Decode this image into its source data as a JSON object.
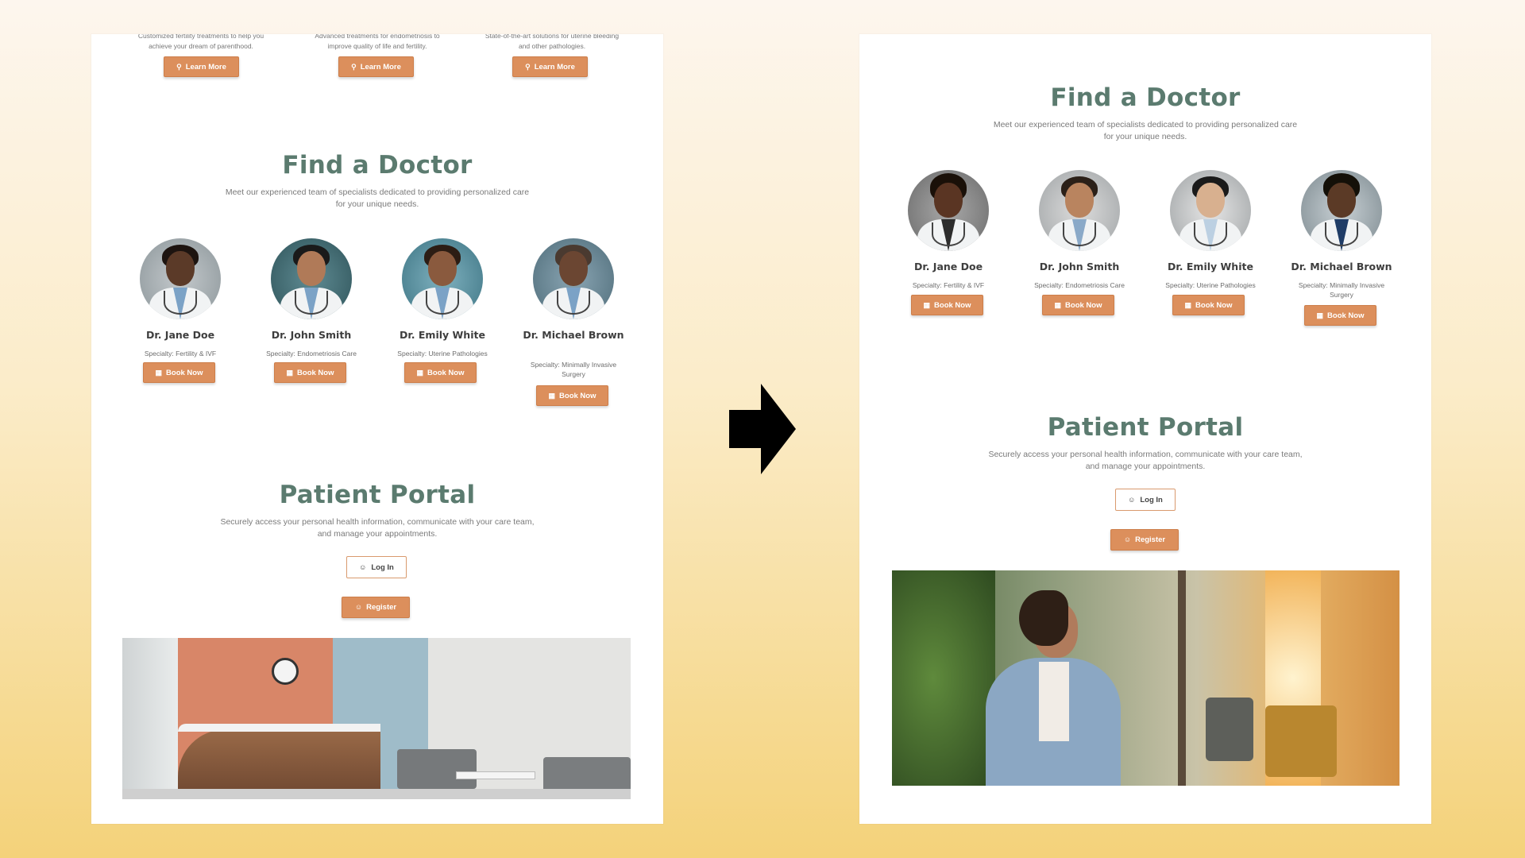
{
  "colors": {
    "accent": "#dc8f5c",
    "title": "#5b7b6f",
    "bg_top": "#fdf6ee",
    "bg_bottom": "#f4d27a"
  },
  "left": {
    "services": [
      {
        "line1": "Customized fertility treatments to help you",
        "line2": "achieve your dream of parenthood.",
        "button": "Learn More",
        "icon": "search-icon"
      },
      {
        "line1": "Advanced treatments for endometriosis to",
        "line2": "improve quality of life and fertility.",
        "button": "Learn More",
        "icon": "search-icon"
      },
      {
        "line1": "State-of-the-art solutions for uterine bleeding",
        "line2": "and other pathologies.",
        "button": "Learn More",
        "icon": "search-icon"
      }
    ],
    "find": {
      "title": "Find a Doctor",
      "desc_line1": "Meet our experienced team of specialists dedicated to providing personalized care",
      "desc_line2": "for your unique needs."
    },
    "doctors": [
      {
        "name": "Dr. Jane Doe",
        "specialty": "Specialty: Fertility & IVF",
        "button": "Book Now"
      },
      {
        "name": "Dr. John Smith",
        "specialty": "Specialty: Endometriosis Care",
        "button": "Book Now"
      },
      {
        "name": "Dr. Emily White",
        "specialty": "Specialty: Uterine Pathologies",
        "button": "Book Now"
      },
      {
        "name": "Dr. Michael Brown",
        "specialty": "Specialty: Minimally Invasive Surgery",
        "button": "Book Now"
      }
    ],
    "portal": {
      "title": "Patient Portal",
      "desc_line1": "Securely access your personal health information, communicate with your care team,",
      "desc_line2": "and manage your appointments.",
      "login": "Log In",
      "register": "Register"
    }
  },
  "right": {
    "find": {
      "title": "Find a Doctor",
      "desc_line1": "Meet our experienced team of specialists dedicated to providing personalized care",
      "desc_line2": "for your unique needs."
    },
    "doctors": [
      {
        "name": "Dr. Jane Doe",
        "specialty": "Specialty: Fertility & IVF",
        "button": "Book Now"
      },
      {
        "name": "Dr. John Smith",
        "specialty": "Specialty: Endometriosis Care",
        "button": "Book Now"
      },
      {
        "name": "Dr. Emily White",
        "specialty": "Specialty: Uterine Pathologies",
        "button": "Book Now"
      },
      {
        "name": "Dr. Michael Brown",
        "specialty": "Specialty: Minimally Invasive Surgery",
        "button": "Book Now"
      }
    ],
    "portal": {
      "title": "Patient Portal",
      "desc_line1": "Securely access your personal health information, communicate with your care team,",
      "desc_line2": "and manage your appointments.",
      "login": "Log In",
      "register": "Register"
    }
  }
}
